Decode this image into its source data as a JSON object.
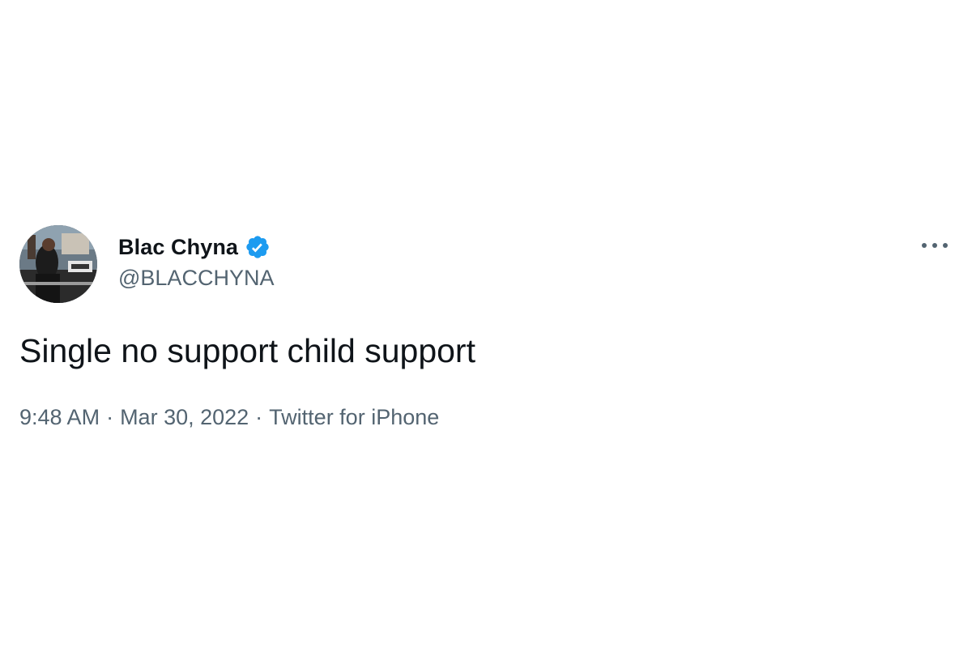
{
  "tweet": {
    "author": {
      "display_name": "Blac Chyna",
      "handle": "@BLACCHYNA",
      "verified": true,
      "avatar_icon": "profile-photo",
      "verified_icon": "verified-badge-icon"
    },
    "more_icon": "more-options-icon",
    "text": "Single no support child support",
    "meta": {
      "time": "9:48 AM",
      "separator": "·",
      "date": "Mar 30, 2022",
      "source": "Twitter for iPhone"
    }
  },
  "colors": {
    "text_primary": "#0f1419",
    "text_secondary": "#536471",
    "verified_blue": "#1d9bf0",
    "background": "#ffffff"
  }
}
